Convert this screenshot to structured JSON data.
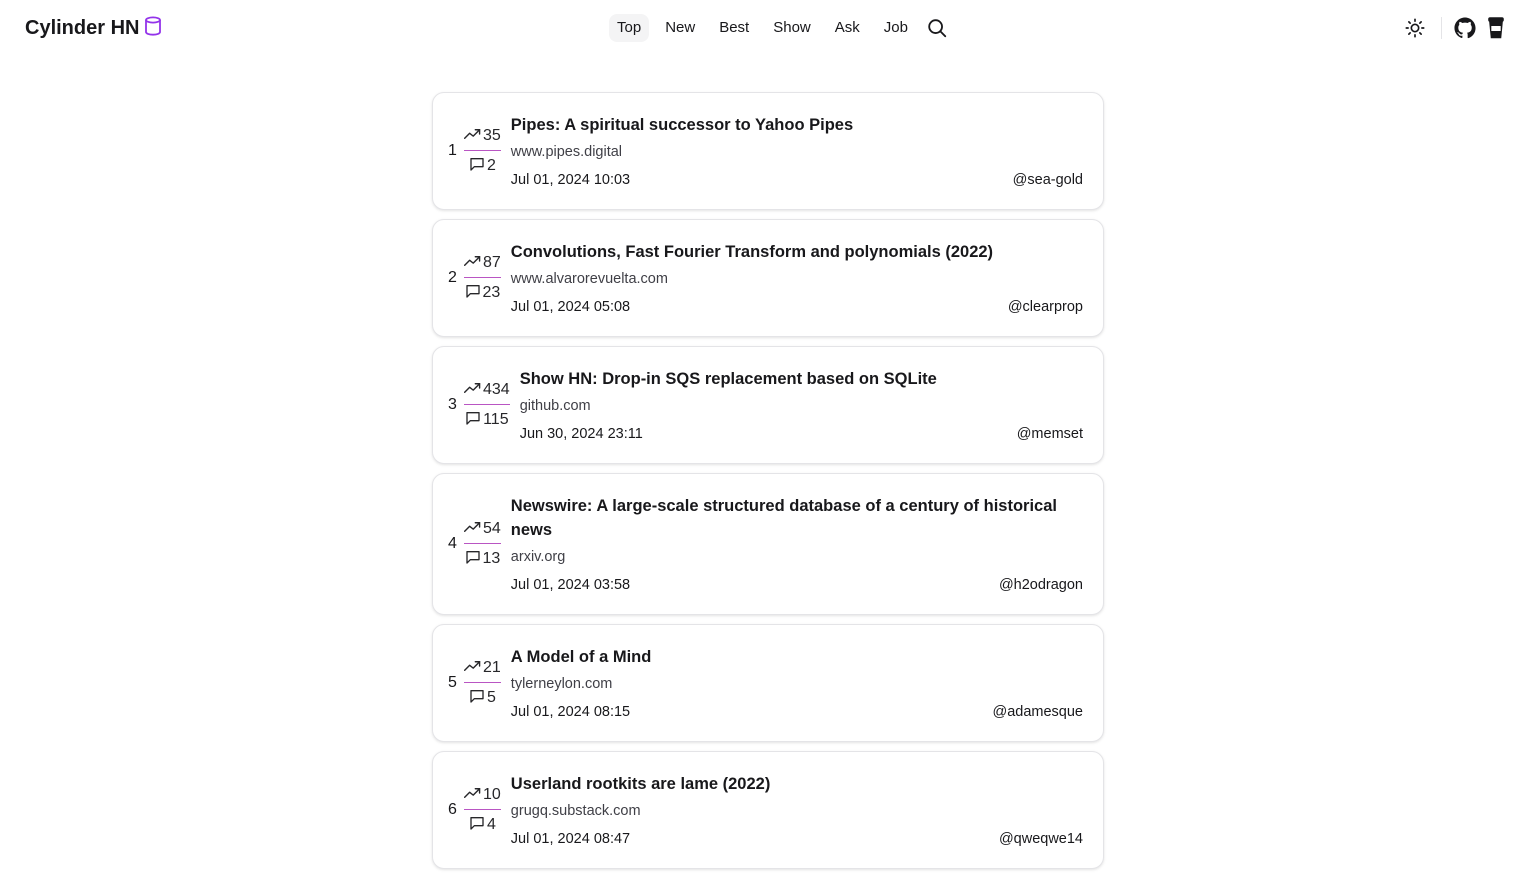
{
  "brand": {
    "name": "Cylinder HN",
    "icon": "cylinder-icon",
    "accent": "#9333ea"
  },
  "nav": {
    "items": [
      "Top",
      "New",
      "Best",
      "Show",
      "Ask",
      "Job"
    ],
    "active": "Top",
    "search_icon": "search-icon"
  },
  "toolbar": {
    "theme_icon": "sun-icon",
    "github_icon": "github-icon",
    "coffee_icon": "coffee-cup-icon"
  },
  "stories": [
    {
      "rank": "1",
      "points": "35",
      "comments": "2",
      "title": "Pipes: A spiritual successor to Yahoo Pipes",
      "domain": "www.pipes.digital",
      "time": "Jul 01, 2024 10:03",
      "user": "@sea-gold"
    },
    {
      "rank": "2",
      "points": "87",
      "comments": "23",
      "title": "Convolutions, Fast Fourier Transform and polynomials (2022)",
      "domain": "www.alvarorevuelta.com",
      "time": "Jul 01, 2024 05:08",
      "user": "@clearprop"
    },
    {
      "rank": "3",
      "points": "434",
      "comments": "115",
      "title": "Show HN: Drop-in SQS replacement based on SQLite",
      "domain": "github.com",
      "time": "Jun 30, 2024 23:11",
      "user": "@memset"
    },
    {
      "rank": "4",
      "points": "54",
      "comments": "13",
      "title": "Newswire: A large-scale structured database of a century of historical news",
      "domain": "arxiv.org",
      "time": "Jul 01, 2024 03:58",
      "user": "@h2odragon"
    },
    {
      "rank": "5",
      "points": "21",
      "comments": "5",
      "title": "A Model of a Mind",
      "domain": "tylerneylon.com",
      "time": "Jul 01, 2024 08:15",
      "user": "@adamesque"
    },
    {
      "rank": "6",
      "points": "10",
      "comments": "4",
      "title": "Userland rootkits are lame (2022)",
      "domain": "grugq.substack.com",
      "time": "Jul 01, 2024 08:47",
      "user": "@qweqwe14"
    }
  ]
}
